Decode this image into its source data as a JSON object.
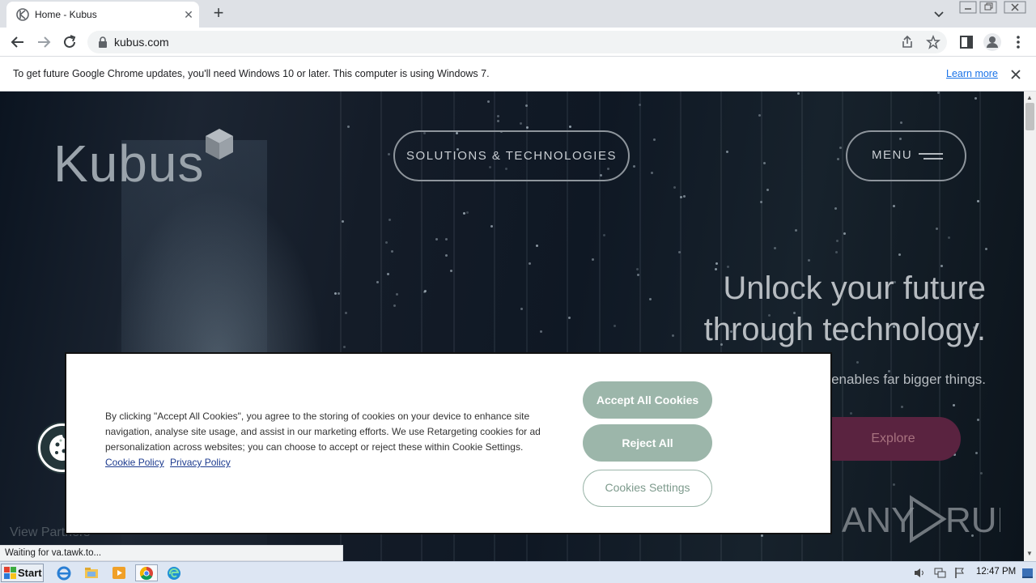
{
  "browser": {
    "tab_title": "Home - Kubus",
    "url": "kubus.com",
    "status_text": "Waiting for va.tawk.to..."
  },
  "infobar": {
    "message": "To get future Google Chrome updates, you'll need Windows 10 or later. This computer is using Windows 7.",
    "link_label": "Learn more"
  },
  "site": {
    "logo": "Kubus",
    "nav_solutions": "SOLUTIONS & TECHNOLOGIES",
    "nav_menu": "MENU",
    "hero_title_line1": "Unlock your future",
    "hero_title_line2": "through technology.",
    "hero_subtitle": "enables far bigger things.",
    "explore_label": "Explore",
    "view_partners": "View Partners"
  },
  "cookie": {
    "text": "By clicking \"Accept All Cookies\", you agree to the storing of cookies on your device to enhance site navigation, analyse site usage, and assist in our marketing efforts. We use Retargeting cookies for ad personalization across websites; you can choose to accept or reject these within Cookie Settings.",
    "cookie_policy_label": "Cookie Policy",
    "privacy_policy_label": "Privacy Policy",
    "accept_label": "Accept All Cookies",
    "reject_label": "Reject All",
    "settings_label": "Cookies Settings"
  },
  "watermark": {
    "text": "ANY RUN"
  },
  "taskbar": {
    "start_label": "Start",
    "clock": "12:47 PM"
  },
  "colors": {
    "accent_sage": "#9cb6aa",
    "explore_bg": "#5a2340",
    "chrome_link": "#1a73e8"
  }
}
